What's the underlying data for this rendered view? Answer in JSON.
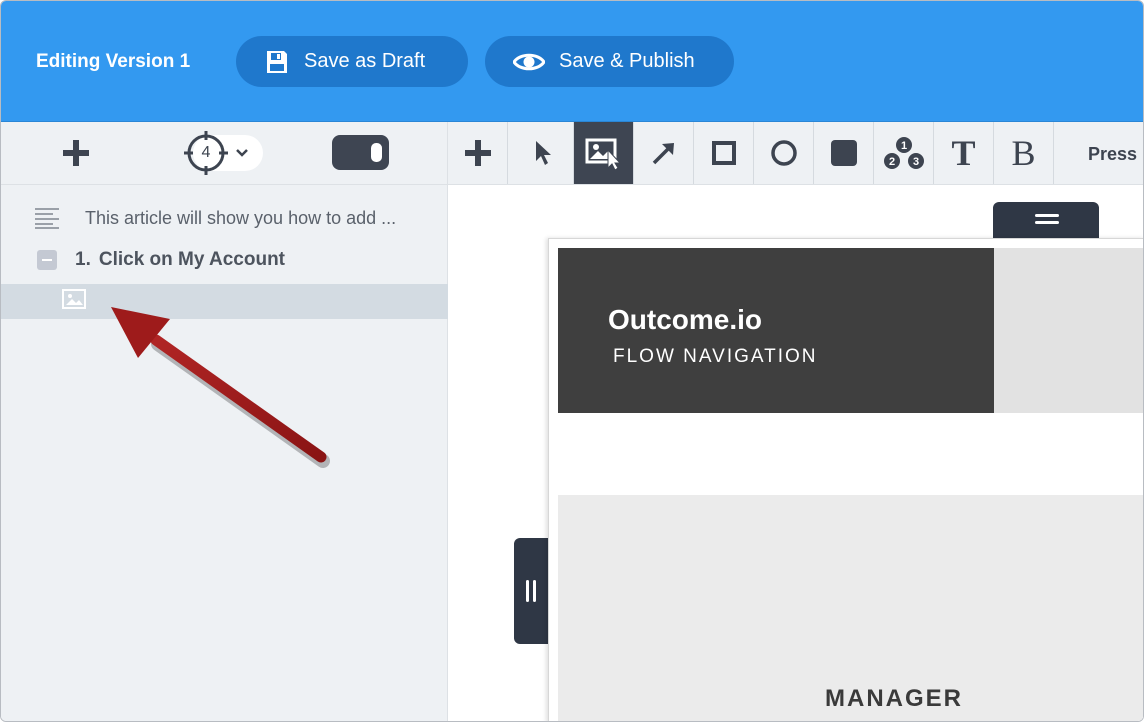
{
  "header": {
    "version_title": "Editing Version 1",
    "save_draft_label": "Save as Draft",
    "save_publish_label": "Save & Publish",
    "bg_color": "#3399f0",
    "button_color": "#1f78cc"
  },
  "left_toolbar": {
    "add_icon": "plus-icon",
    "step_number": "4",
    "toggle_state": "on"
  },
  "right_toolbar": {
    "tools": [
      {
        "name": "add",
        "icon": "plus-icon"
      },
      {
        "name": "select",
        "icon": "pointer-icon"
      },
      {
        "name": "image-select",
        "icon": "image-cursor-icon",
        "active": true
      },
      {
        "name": "arrow",
        "icon": "arrow-icon"
      },
      {
        "name": "rectangle",
        "icon": "square-icon"
      },
      {
        "name": "circle",
        "icon": "circle-icon"
      },
      {
        "name": "fill-rect",
        "icon": "filled-square-icon"
      },
      {
        "name": "numbering",
        "icon": "numbered-steps-icon"
      },
      {
        "name": "text",
        "label": "T"
      },
      {
        "name": "bold",
        "label": "B"
      }
    ],
    "press_label": "Press"
  },
  "left_panel": {
    "intro_text": "This article will show you how to add ...",
    "step_number": "1.",
    "step_title": "Click on My Account"
  },
  "canvas": {
    "brand": "Outcome.io",
    "subtitle": "FLOW NAVIGATION",
    "manager_label": "MANAGER"
  },
  "annotation": {
    "arrow_color": "#9e1b1b"
  }
}
